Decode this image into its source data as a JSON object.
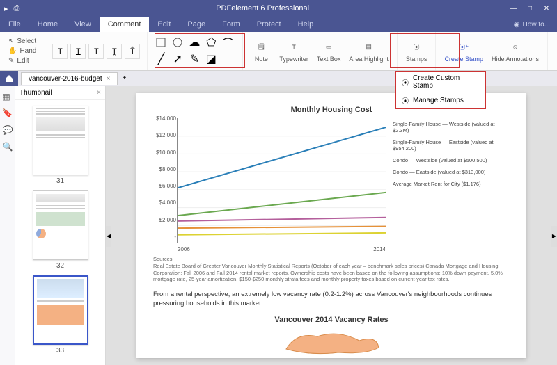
{
  "app": {
    "title": "PDFelement 6 Professional"
  },
  "menu": {
    "items": [
      "File",
      "Home",
      "View",
      "Comment",
      "Edit",
      "Page",
      "Form",
      "Protect",
      "Help"
    ],
    "active": "Comment",
    "howto": "How to..."
  },
  "ribbon": {
    "select_tools": {
      "select": "Select",
      "hand": "Hand",
      "edit": "Edit"
    },
    "annotate": {
      "note": "Note",
      "typewriter": "Typewriter",
      "textbox": "Text Box",
      "area_highlight": "Area Highlight",
      "stamps": "Stamps"
    },
    "stamp_group": {
      "create": "Create Stamp",
      "hide": "Hide Annotations"
    },
    "dropdown": {
      "create_custom": "Create Custom Stamp",
      "manage": "Manage Stamps"
    }
  },
  "tabs": {
    "doc": "vancouver-2016-budget"
  },
  "thumbnail": {
    "title": "Thumbnail",
    "pages": [
      31,
      32,
      33
    ],
    "selected": 33
  },
  "page": {
    "chart_title": "Monthly Housing Cost",
    "sources_label": "Sources:",
    "sources_text": "Real Estate Board of Greater Vancouver Monthly Statistical Reports (October of each year – benchmark sales prices) Canada Mortgage and Housing Corporation; Fall 2006 and Fall 2014 rental market reports. Ownership costs have been based on the following assumptions: 10% down payment, 5.0% mortgage rate, 25-year amortization, $150-$250 monthly strata fees and monthly property taxes based on current-year tax rates.",
    "body": "From a rental perspective, an extremely low vacancy rate (0.2-1.2%) across Vancouver's neighbourhoods continues pressuring households in this market.",
    "vacancy_title": "Vancouver 2014 Vacancy Rates"
  },
  "chart_data": {
    "type": "line",
    "title": "Monthly Housing Cost",
    "xlabel": "",
    "ylabel": "",
    "x": [
      2006,
      2014
    ],
    "ylim": [
      0,
      14000
    ],
    "yticks": [
      "$14,000",
      "$12,000",
      "$10,000",
      "$8,000",
      "$6,000",
      "$4,000",
      "$2,000",
      "-"
    ],
    "xticks": [
      "2006",
      "2014"
    ],
    "series": [
      {
        "name": "Single-Family House — Westside (valued at $2.3M)",
        "color": "#2a7fb8",
        "y": [
          6200,
          13000
        ]
      },
      {
        "name": "Single-Family House — Eastside (valued at $954,200)",
        "color": "#6aa84f",
        "y": [
          3100,
          5700
        ]
      },
      {
        "name": "Condo — Westside (valued at $500,500)",
        "color": "#b45f9c",
        "y": [
          2500,
          2900
        ]
      },
      {
        "name": "Condo — Eastside (valued at $313,000)",
        "color": "#e69138",
        "y": [
          1700,
          1900
        ]
      },
      {
        "name": "Average Market Rent for City ($1,176)",
        "color": "#dcd232",
        "y": [
          950,
          1176
        ]
      }
    ]
  }
}
